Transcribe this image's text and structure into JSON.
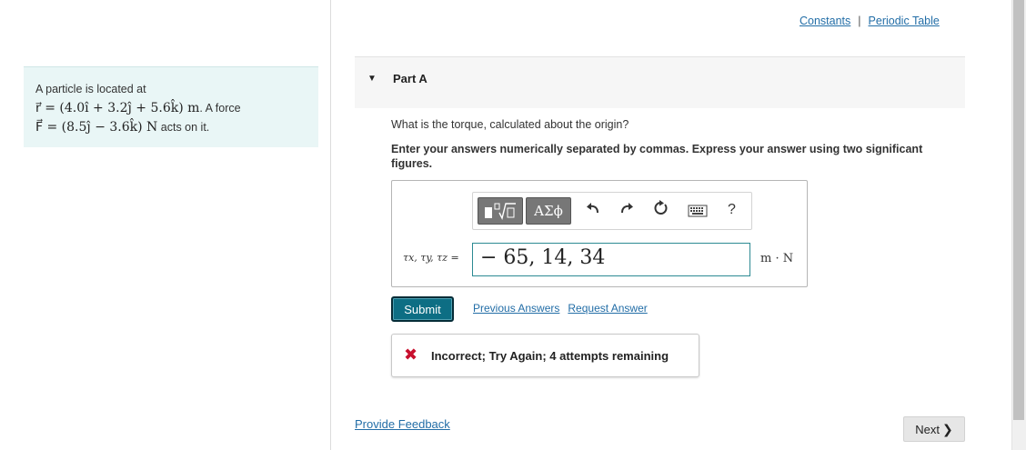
{
  "problem": {
    "line1": "A particle is located at",
    "r_math": "r⃗ = (4.0î + 3.2ĵ + 5.6k̂) m",
    "r_suffix": ". A force",
    "f_math": "F⃗ = (8.5ĵ − 3.6k̂) N",
    "f_suffix": " acts on it."
  },
  "top_links": {
    "constants": "Constants",
    "separator": "|",
    "periodic_table": "Periodic Table"
  },
  "part": {
    "title": "Part A"
  },
  "question": "What is the torque, calculated about the origin?",
  "instruction": "Enter your answers numerically separated by commas. Express your answer using two significant figures.",
  "toolbar": {
    "templates_icon": "templates-icon",
    "symbols_label": "ΑΣϕ",
    "undo_icon": "undo-icon",
    "redo_icon": "redo-icon",
    "reset_icon": "reset-icon",
    "keyboard_icon": "keyboard-icon",
    "help_label": "?"
  },
  "answer": {
    "label": "τx, τy, τz =",
    "value": "− 65, 14, 34",
    "unit": "m · N"
  },
  "submit_label": "Submit",
  "previous_answers": "Previous Answers",
  "request_answer": "Request Answer",
  "feedback": "Incorrect; Try Again; 4 attempts remaining",
  "provide_feedback": "Provide Feedback",
  "next_label": "Next",
  "colors": {
    "accent": "#0d6e84",
    "link": "#236ea7",
    "error": "#c8102e",
    "problem_bg": "#e9f6f6"
  }
}
